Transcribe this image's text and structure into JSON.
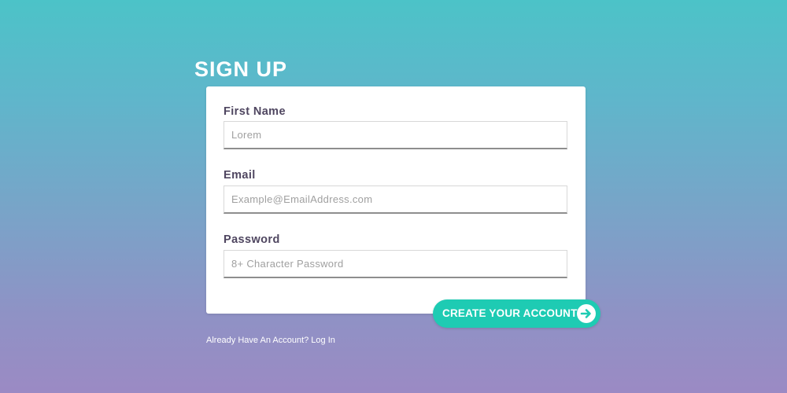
{
  "page": {
    "title": "SIGN UP"
  },
  "form": {
    "first_name": {
      "label": "First Name",
      "placeholder": "Lorem",
      "value": ""
    },
    "email": {
      "label": "Email",
      "placeholder": "Example@EmailAddress.com",
      "value": ""
    },
    "password": {
      "label": "Password",
      "placeholder": "8+ Character Password",
      "value": ""
    }
  },
  "submit": {
    "label": "CREATE YOUR ACCOUNT",
    "icon": "arrow-right-circle-icon"
  },
  "footer": {
    "login_text": "Already Have An Account? Log In"
  },
  "colors": {
    "gradient_top": "#4cc3c8",
    "gradient_bottom": "#9b8ac4",
    "button": "#1ecbb3",
    "label_text": "#4f4660",
    "card": "#ffffff"
  }
}
